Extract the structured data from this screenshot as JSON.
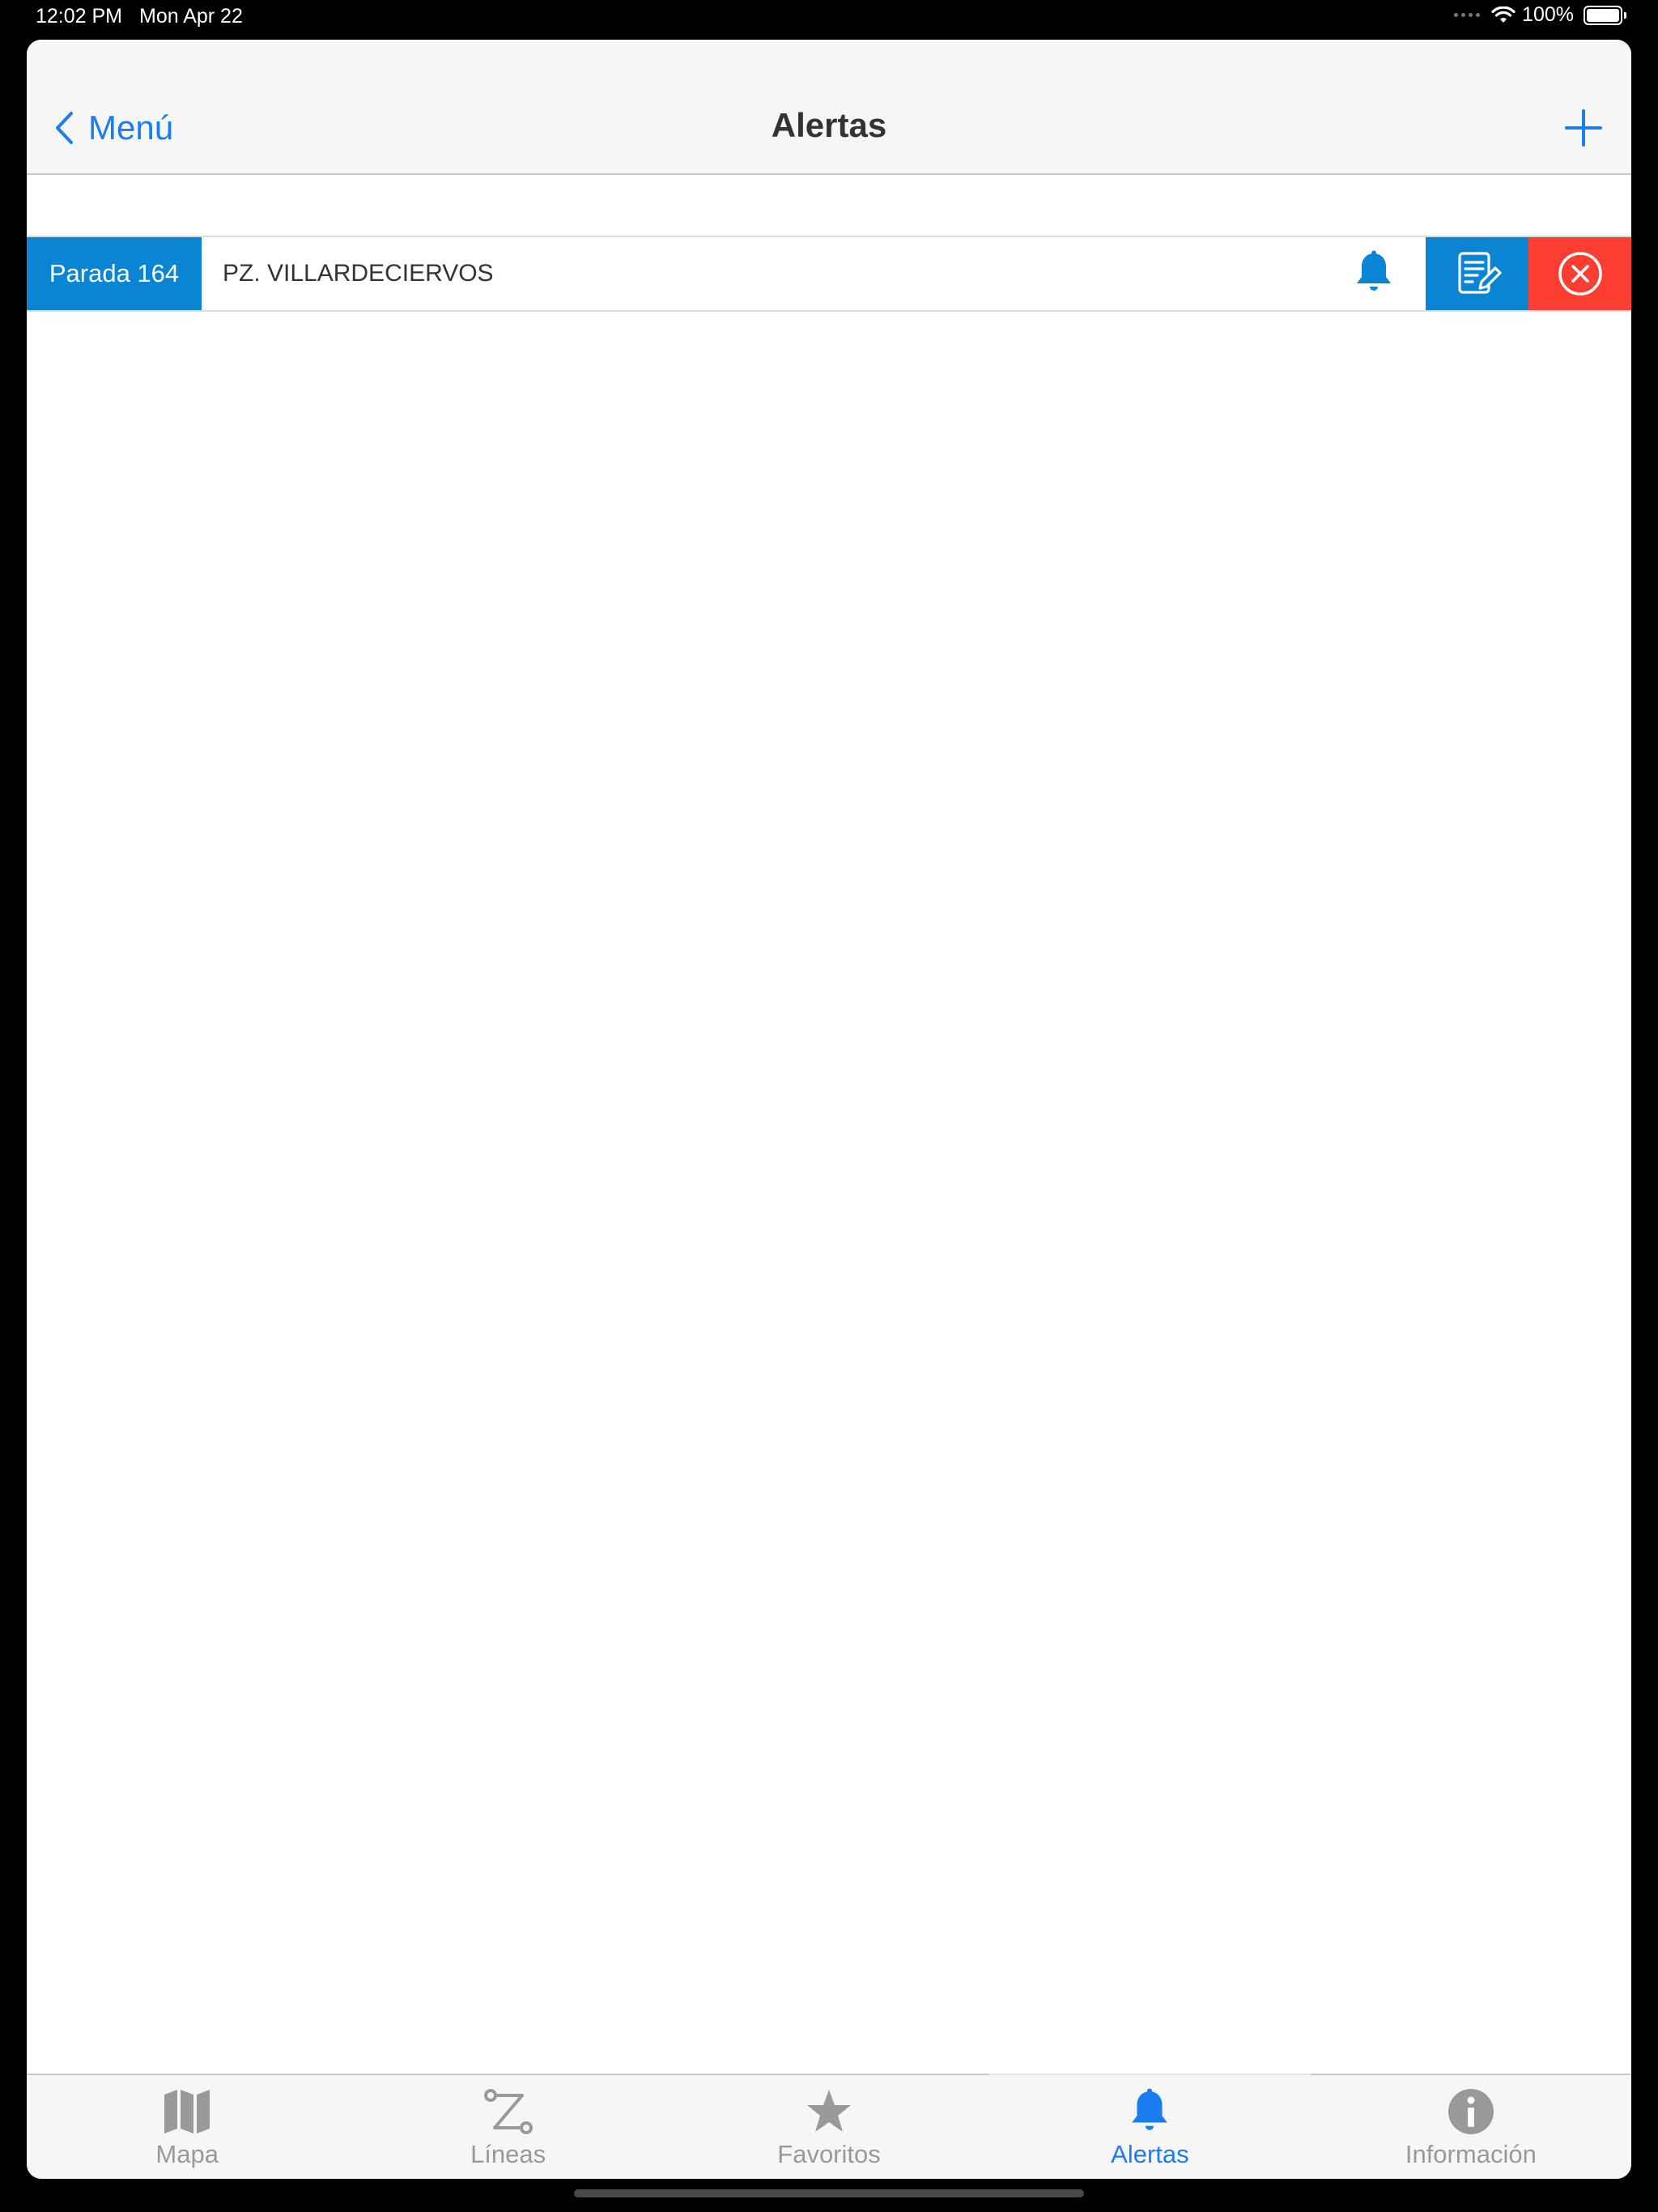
{
  "status_bar": {
    "time": "12:02 PM",
    "date": "Mon Apr 22",
    "battery": "100%"
  },
  "nav": {
    "back_label": "Menú",
    "title": "Alertas"
  },
  "alerts": [
    {
      "stop_label": "Parada 164",
      "stop_name": "PZ. VILLARDECIERVOS"
    }
  ],
  "tabs": [
    {
      "label": "Mapa",
      "icon": "map-icon",
      "active": false
    },
    {
      "label": "Líneas",
      "icon": "route-icon",
      "active": false
    },
    {
      "label": "Favoritos",
      "icon": "star-icon",
      "active": false
    },
    {
      "label": "Alertas",
      "icon": "bell-icon",
      "active": true
    },
    {
      "label": "Información",
      "icon": "info-icon",
      "active": false
    }
  ],
  "colors": {
    "accent": "#1a7ef0",
    "stop_badge": "#0a85d4",
    "delete": "#fc3d32",
    "inactive_tab": "#999999"
  }
}
